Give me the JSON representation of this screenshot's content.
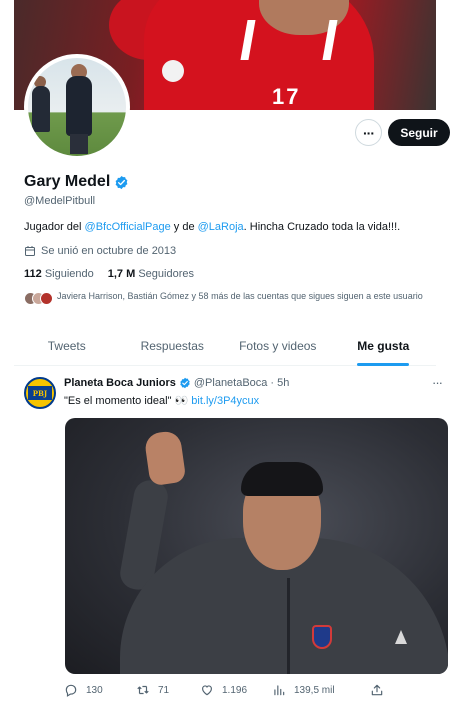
{
  "profile": {
    "name": "Gary Medel",
    "handle": "@MedelPitbull",
    "bio": {
      "prefix": "Jugador del ",
      "mention1": "@BfcOfficialPage",
      "middle": " y de ",
      "mention2": "@LaRoja",
      "suffix": ". Hincha Cruzado toda la vida!!!."
    },
    "joined": "Se unió en octubre de 2013",
    "following_count": "112",
    "following_label": "Siguiendo",
    "followers_count": "1,7 M",
    "followers_label": "Seguidores",
    "known_followers": "Javiera Harrison, Bastián Gómez y 58 más de las cuentas que sigues siguen a este usuario",
    "banner_number": "17",
    "follow_button": "Seguir",
    "more_button": "···"
  },
  "tabs": [
    "Tweets",
    "Respuestas",
    "Fotos y videos",
    "Me gusta"
  ],
  "active_tab": "Me gusta",
  "tweet": {
    "author": "Planeta Boca Juniors",
    "handle": "@PlanetaBoca",
    "separator": "·",
    "time": "5h",
    "avatar_text": "PBJ",
    "text": "\"Es el momento ideal\" 👀 ",
    "link": "bit.ly/3P4ycux",
    "more": "···",
    "replies": "130",
    "retweets": "71",
    "likes": "1.196",
    "views": "139,5 mil"
  },
  "colors": {
    "accent": "#1d9bf0",
    "text": "#0f1419",
    "secondary": "#536471"
  }
}
